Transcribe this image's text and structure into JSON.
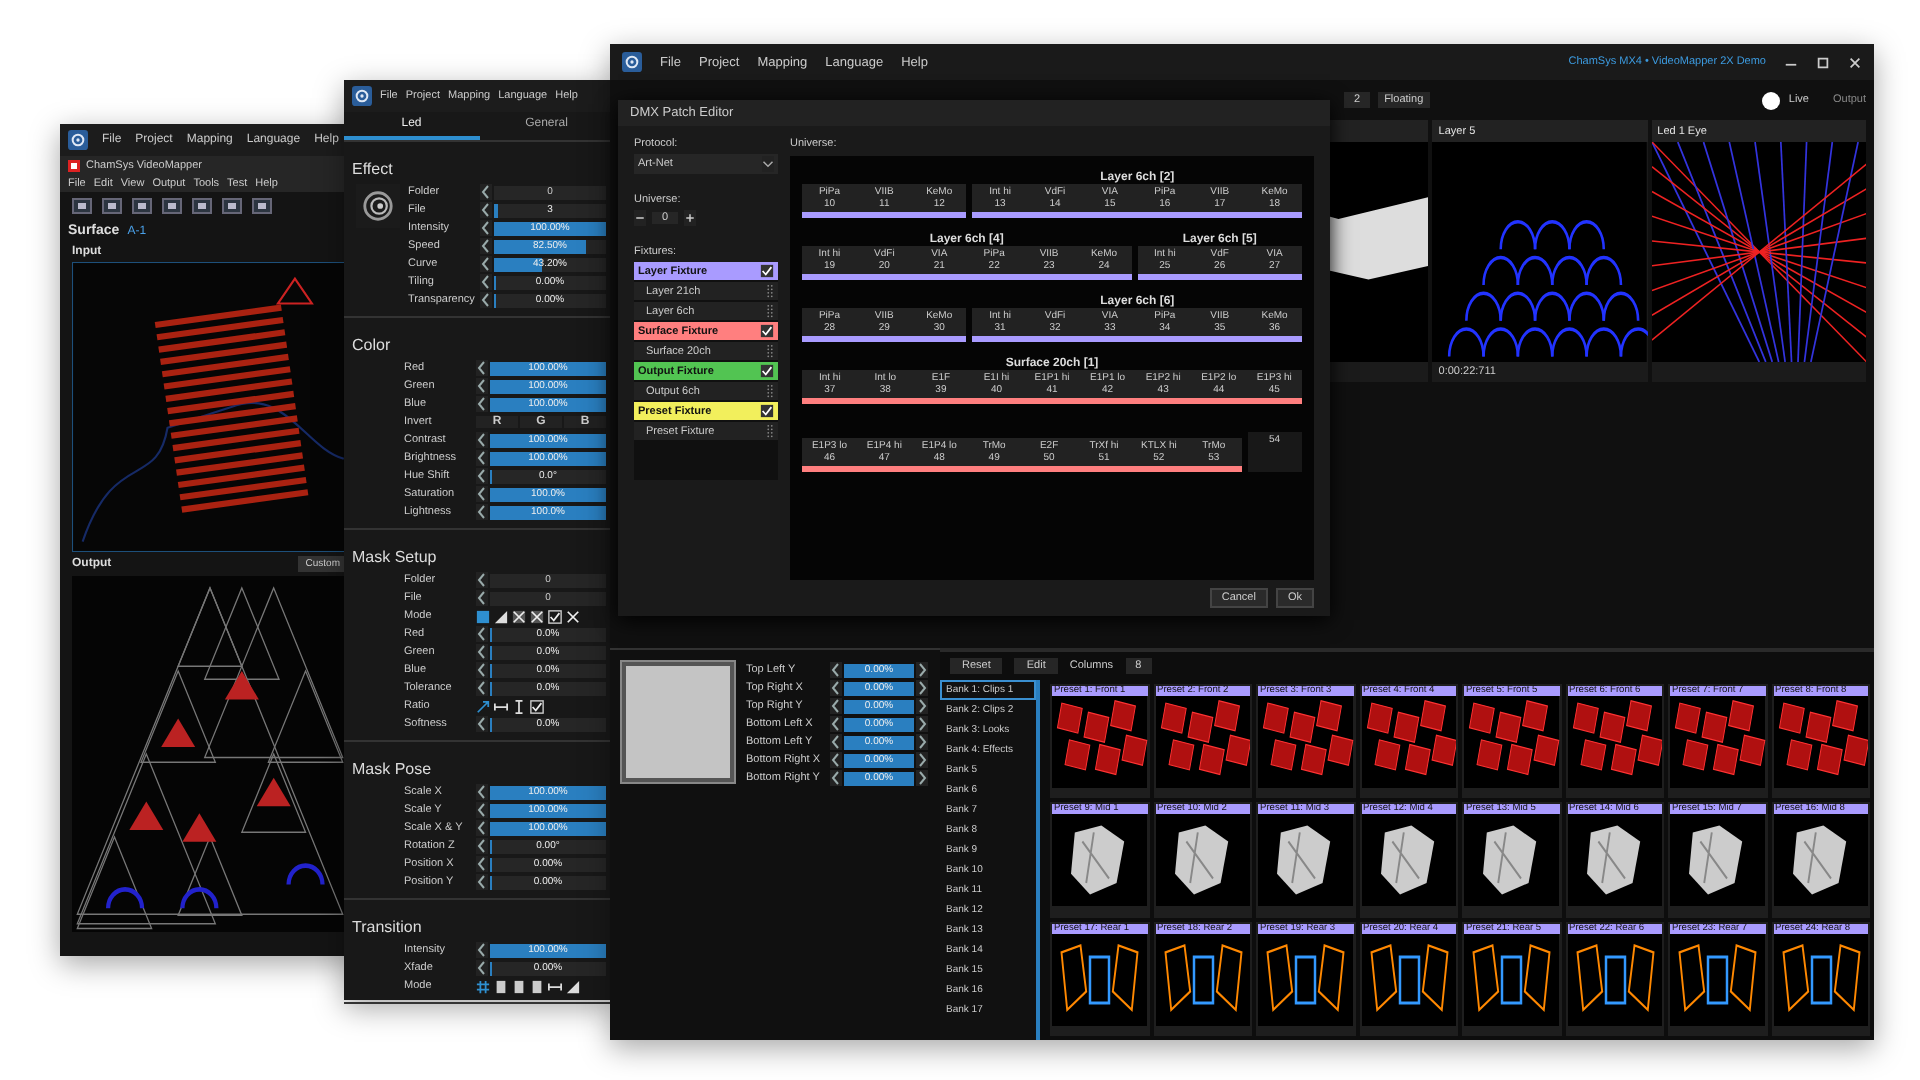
{
  "left_window": {
    "menu": [
      "File",
      "Project",
      "Mapping",
      "Language",
      "Help"
    ],
    "app_title": "ChamSys VideoMapper",
    "app_menu": [
      "File",
      "Edit",
      "View",
      "Output",
      "Tools",
      "Test",
      "Help"
    ],
    "surface_label": "Surface",
    "surface_id": "A-1",
    "input_label": "Input",
    "output_label": "Output",
    "output_mode": "Custom"
  },
  "panel_window": {
    "menu": [
      "File",
      "Project",
      "Mapping",
      "Language",
      "Help"
    ],
    "tabs": [
      {
        "label": "Led",
        "selected": true
      },
      {
        "label": "General",
        "selected": false
      }
    ],
    "sections": [
      {
        "title": "Effect",
        "thumbnail": true,
        "rows": [
          {
            "kind": "stepper",
            "label": "Folder",
            "value": "0"
          },
          {
            "kind": "slider",
            "label": "File",
            "value": "3",
            "level": 0.03
          },
          {
            "kind": "slider",
            "label": "Intensity",
            "value": "100.00%",
            "level": 1
          },
          {
            "kind": "slider",
            "label": "Speed",
            "value": "82.50%",
            "level": 0.825
          },
          {
            "kind": "slider",
            "label": "Curve",
            "value": "43.20%",
            "level": 0.432
          },
          {
            "kind": "slider",
            "label": "Tiling",
            "value": "0.00%",
            "level": 0
          },
          {
            "kind": "slider",
            "label": "Transparency",
            "value": "0.00%",
            "level": 0
          }
        ]
      },
      {
        "title": "Color",
        "thumbnail": false,
        "rows": [
          {
            "kind": "slider",
            "label": "Red",
            "value": "100.00%",
            "level": 1
          },
          {
            "kind": "slider",
            "label": "Green",
            "value": "100.00%",
            "level": 1
          },
          {
            "kind": "slider",
            "label": "Blue",
            "value": "100.00%",
            "level": 1
          },
          {
            "kind": "rgb",
            "label": "Invert",
            "buttons": [
              "R",
              "G",
              "B"
            ]
          },
          {
            "kind": "slider",
            "label": "Contrast",
            "value": "100.00%",
            "level": 1
          },
          {
            "kind": "slider",
            "label": "Brightness",
            "value": "100.00%",
            "level": 1
          },
          {
            "kind": "slider",
            "label": "Hue Shift",
            "value": "0.0°",
            "level": 0
          },
          {
            "kind": "slider",
            "label": "Saturation",
            "value": "100.0%",
            "level": 1
          },
          {
            "kind": "slider",
            "label": "Lightness",
            "value": "100.0%",
            "level": 1
          }
        ]
      },
      {
        "title": "Mask Setup",
        "thumbnail": false,
        "rows": [
          {
            "kind": "stepper",
            "label": "Folder",
            "value": "0"
          },
          {
            "kind": "stepper",
            "label": "File",
            "value": "0"
          },
          {
            "kind": "mode-icons",
            "label": "Mode"
          },
          {
            "kind": "slider",
            "label": "Red",
            "value": "0.0%",
            "level": 0
          },
          {
            "kind": "slider",
            "label": "Green",
            "value": "0.0%",
            "level": 0
          },
          {
            "kind": "slider",
            "label": "Blue",
            "value": "0.0%",
            "level": 0
          },
          {
            "kind": "slider",
            "label": "Tolerance",
            "value": "0.0%",
            "level": 0
          },
          {
            "kind": "ratio-icons",
            "label": "Ratio"
          },
          {
            "kind": "slider",
            "label": "Softness",
            "value": "0.0%",
            "level": 0
          }
        ]
      },
      {
        "title": "Mask Pose",
        "thumbnail": false,
        "rows": [
          {
            "kind": "slider",
            "label": "Scale X",
            "value": "100.00%",
            "level": 1
          },
          {
            "kind": "slider",
            "label": "Scale Y",
            "value": "100.00%",
            "level": 1
          },
          {
            "kind": "slider",
            "label": "Scale X & Y",
            "value": "100.00%",
            "level": 1
          },
          {
            "kind": "slider",
            "label": "Rotation Z",
            "value": "0.00°",
            "level": 0
          },
          {
            "kind": "slider",
            "label": "Position X",
            "value": "0.00%",
            "level": 0
          },
          {
            "kind": "slider",
            "label": "Position Y",
            "value": "0.00%",
            "level": 0
          }
        ]
      },
      {
        "title": "Transition",
        "thumbnail": false,
        "rows": [
          {
            "kind": "slider",
            "label": "Intensity",
            "value": "100.00%",
            "level": 1
          },
          {
            "kind": "slider",
            "label": "Xfade",
            "value": "0.00%",
            "level": 0
          },
          {
            "kind": "transition-icons",
            "label": "Mode"
          }
        ]
      }
    ]
  },
  "main_window": {
    "menu": [
      "File",
      "Project",
      "Mapping",
      "Language",
      "Help"
    ],
    "title": "ChamSys MX4 • VideoMapper 2X Demo",
    "toolbar": {
      "value": "2",
      "mode": "Floating",
      "live": true,
      "live_label": "Live"
    },
    "output_label": "Output",
    "previews": [
      {
        "kind": "wave"
      },
      {
        "kind": "dome",
        "title": "Layer 5",
        "timecode": "0:00:22:711"
      },
      {
        "kind": "mesh",
        "title": "Led 1 Eye"
      }
    ],
    "corner_pin": [
      {
        "label": "Top Left Y",
        "value": "0.00%",
        "level": 1
      },
      {
        "label": "Top Right X",
        "value": "0.00%",
        "level": 1
      },
      {
        "label": "Top Right Y",
        "value": "0.00%",
        "level": 1
      },
      {
        "label": "Bottom Left X",
        "value": "0.00%",
        "level": 1
      },
      {
        "label": "Bottom Left Y",
        "value": "0.00%",
        "level": 1
      },
      {
        "label": "Bottom Right X",
        "value": "0.00%",
        "level": 1
      },
      {
        "label": "Bottom Right Y",
        "value": "0.00%",
        "level": 1
      }
    ],
    "presets_toolbar": {
      "reset": "Reset",
      "edit": "Edit",
      "columns_label": "Columns",
      "columns": "8"
    },
    "banks": [
      {
        "label": "Bank 1: Clips 1",
        "selected": true
      },
      {
        "label": "Bank 2: Clips 2",
        "selected": false
      },
      {
        "label": "Bank 3: Looks",
        "selected": false
      },
      {
        "label": "Bank 4: Effects",
        "selected": false
      },
      {
        "label": "Bank 5",
        "selected": false
      },
      {
        "label": "Bank 6",
        "selected": false
      },
      {
        "label": "Bank 7",
        "selected": false
      },
      {
        "label": "Bank 8",
        "selected": false
      },
      {
        "label": "Bank 9",
        "selected": false
      },
      {
        "label": "Bank 10",
        "selected": false
      },
      {
        "label": "Bank 11",
        "selected": false
      },
      {
        "label": "Bank 12",
        "selected": false
      },
      {
        "label": "Bank 13",
        "selected": false
      },
      {
        "label": "Bank 14",
        "selected": false
      },
      {
        "label": "Bank 15",
        "selected": false
      },
      {
        "label": "Bank 16",
        "selected": false
      },
      {
        "label": "Bank 17",
        "selected": false
      }
    ],
    "presets": [
      {
        "label": "Preset 1: Front 1",
        "kind": "cubes"
      },
      {
        "label": "Preset 2: Front 2",
        "kind": "cubes"
      },
      {
        "label": "Preset 3: Front 3",
        "kind": "cubes"
      },
      {
        "label": "Preset 4: Front 4",
        "kind": "cubes"
      },
      {
        "label": "Preset 5: Front 5",
        "kind": "cubes"
      },
      {
        "label": "Preset 6: Front 6",
        "kind": "cubes"
      },
      {
        "label": "Preset 7: Front 7",
        "kind": "cubes"
      },
      {
        "label": "Preset 8: Front 8",
        "kind": "cubes"
      },
      {
        "label": "Preset 9: Mid 1",
        "kind": "shape"
      },
      {
        "label": "Preset 10: Mid 2",
        "kind": "shape"
      },
      {
        "label": "Preset 11: Mid 3",
        "kind": "shape"
      },
      {
        "label": "Preset 12: Mid 4",
        "kind": "shape"
      },
      {
        "label": "Preset 13: Mid 5",
        "kind": "shape"
      },
      {
        "label": "Preset 14: Mid 6",
        "kind": "shape"
      },
      {
        "label": "Preset 15: Mid 7",
        "kind": "shape"
      },
      {
        "label": "Preset 16: Mid 8",
        "kind": "shape"
      },
      {
        "label": "Preset 17: Rear 1",
        "kind": "neon"
      },
      {
        "label": "Preset 18: Rear 2",
        "kind": "neon"
      },
      {
        "label": "Preset 19: Rear 3",
        "kind": "neon"
      },
      {
        "label": "Preset 20: Rear 4",
        "kind": "neon"
      },
      {
        "label": "Preset 21: Rear 5",
        "kind": "neon"
      },
      {
        "label": "Preset 22: Rear 6",
        "kind": "neon"
      },
      {
        "label": "Preset 23: Rear 7",
        "kind": "neon"
      },
      {
        "label": "Preset 24: Rear 8",
        "kind": "neon"
      }
    ]
  },
  "dmx_dialog": {
    "title": "DMX Patch Editor",
    "protocol_label": "Protocol:",
    "protocol": "Art-Net",
    "universe_label": "Universe:",
    "universe": "0",
    "fixtures_label": "Fixtures:",
    "fixtures": [
      {
        "name": "Layer Fixture",
        "color": "#a99bff",
        "checked": true,
        "children": [
          {
            "name": "Layer 21ch"
          },
          {
            "name": "Layer 6ch"
          }
        ]
      },
      {
        "name": "Surface Fixture",
        "color": "#ff7f7f",
        "checked": true,
        "children": [
          {
            "name": "Surface 20ch"
          }
        ]
      },
      {
        "name": "Output Fixture",
        "color": "#52c452",
        "checked": true,
        "children": [
          {
            "name": "Output 6ch"
          }
        ]
      },
      {
        "name": "Preset Fixture",
        "color": "#f2ef5c",
        "checked": true,
        "children": [
          {
            "name": "Preset Fixture"
          }
        ]
      }
    ],
    "map_label": "Universe:",
    "rows": [
      [
        {
          "color": "#a99bff",
          "channels": [
            {
              "name": "PiPa",
              "number": "10"
            },
            {
              "name": "VIIB",
              "number": "11"
            },
            {
              "name": "KeMo",
              "number": "12"
            }
          ]
        },
        {
          "title": "Layer 6ch [2]",
          "color": "#a99bff",
          "channels": [
            {
              "name": "Int hi",
              "number": "13"
            },
            {
              "name": "VdFi",
              "number": "14"
            },
            {
              "name": "VIA",
              "number": "15"
            },
            {
              "name": "PiPa",
              "number": "16"
            },
            {
              "name": "VIIB",
              "number": "17"
            },
            {
              "name": "KeMo",
              "number": "18"
            }
          ]
        }
      ],
      [
        {
          "title": "Layer 6ch [4]",
          "color": "#a99bff",
          "channels": [
            {
              "name": "Int hi",
              "number": "19"
            },
            {
              "name": "VdFi",
              "number": "20"
            },
            {
              "name": "VIA",
              "number": "21"
            },
            {
              "name": "PiPa",
              "number": "22"
            },
            {
              "name": "VIIB",
              "number": "23"
            },
            {
              "name": "KeMo",
              "number": "24"
            }
          ]
        },
        {
          "title": "Layer 6ch [5]",
          "color": "#a99bff",
          "channels": [
            {
              "name": "Int hi",
              "number": "25"
            },
            {
              "name": "VdF",
              "number": "26"
            },
            {
              "name": "VIA",
              "number": "27"
            }
          ]
        }
      ],
      [
        {
          "color": "#a99bff",
          "channels": [
            {
              "name": "PiPa",
              "number": "28"
            },
            {
              "name": "VIIB",
              "number": "29"
            },
            {
              "name": "KeMo",
              "number": "30"
            }
          ]
        },
        {
          "title": "Layer 6ch [6]",
          "color": "#a99bff",
          "channels": [
            {
              "name": "Int hi",
              "number": "31"
            },
            {
              "name": "VdFi",
              "number": "32"
            },
            {
              "name": "VIA",
              "number": "33"
            },
            {
              "name": "PiPa",
              "number": "34"
            },
            {
              "name": "VIIB",
              "number": "35"
            },
            {
              "name": "KeMo",
              "number": "36"
            }
          ]
        }
      ],
      [
        {
          "title": "Surface 20ch [1]",
          "color": "#ff7f7f",
          "channels": [
            {
              "name": "Int hi",
              "number": "37"
            },
            {
              "name": "Int lo",
              "number": "38"
            },
            {
              "name": "E1F",
              "number": "39"
            },
            {
              "name": "E1I hi",
              "number": "40"
            },
            {
              "name": "E1P1 hi",
              "number": "41"
            },
            {
              "name": "E1P1 lo",
              "number": "42"
            },
            {
              "name": "E1P2 hi",
              "number": "43"
            },
            {
              "name": "E1P2 lo",
              "number": "44"
            },
            {
              "name": "E1P3 hi",
              "number": "45"
            }
          ]
        }
      ],
      [
        {
          "color": "#ff7f7f",
          "channels": [
            {
              "name": "E1P3 lo",
              "number": "46"
            },
            {
              "name": "E1P4 hi",
              "number": "47"
            },
            {
              "name": "E1P4 lo",
              "number": "48"
            },
            {
              "name": "TrMo",
              "number": "49"
            },
            {
              "name": "E2F",
              "number": "50"
            },
            {
              "name": "TrXf hi",
              "number": "51"
            },
            {
              "name": "KTLX hi",
              "number": "52"
            },
            {
              "name": "TrMo",
              "number": "53"
            }
          ]
        },
        {
          "channels": [
            {
              "number": "54"
            }
          ]
        }
      ]
    ],
    "buttons": [
      "Cancel",
      "Ok"
    ]
  }
}
